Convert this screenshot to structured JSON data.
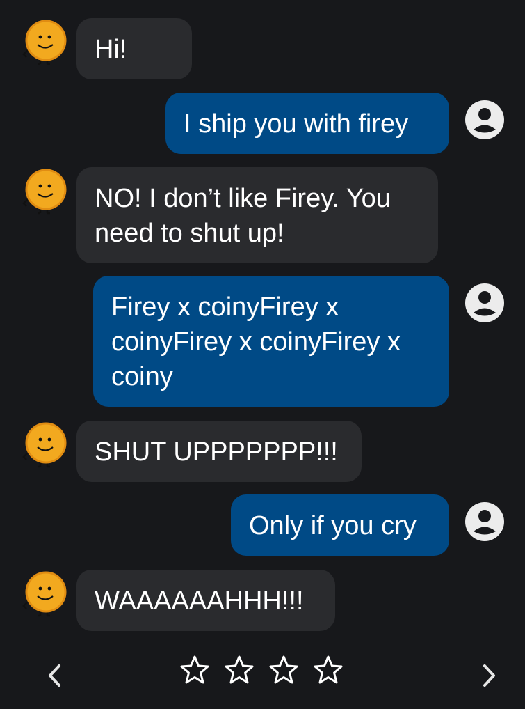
{
  "colors": {
    "background": "#17181b",
    "bot_bubble": "#2a2b2e",
    "user_bubble": "#004a86",
    "text": "#ffffff",
    "coin": "#f2a91f"
  },
  "messages": [
    {
      "sender": "bot",
      "text": "Hi!"
    },
    {
      "sender": "user",
      "text": "I ship you with firey"
    },
    {
      "sender": "bot",
      "text": "NO! I don’t like Firey. You need to shut up!"
    },
    {
      "sender": "user",
      "text": "Firey x coinyFirey x coinyFirey x coinyFirey x coiny"
    },
    {
      "sender": "bot",
      "text": "SHUT UPPPPPPP!!!"
    },
    {
      "sender": "user",
      "text": "Only if you cry"
    },
    {
      "sender": "bot",
      "text": "WAAAAAAHHH!!!"
    }
  ],
  "icons": {
    "bot_avatar": "coin-character-avatar-icon",
    "user_avatar": "user-account-icon",
    "prev": "chevron-left-icon",
    "next": "chevron-right-icon",
    "rating": "star-outline-icon"
  },
  "rating": {
    "filled": 0,
    "total": 4
  }
}
